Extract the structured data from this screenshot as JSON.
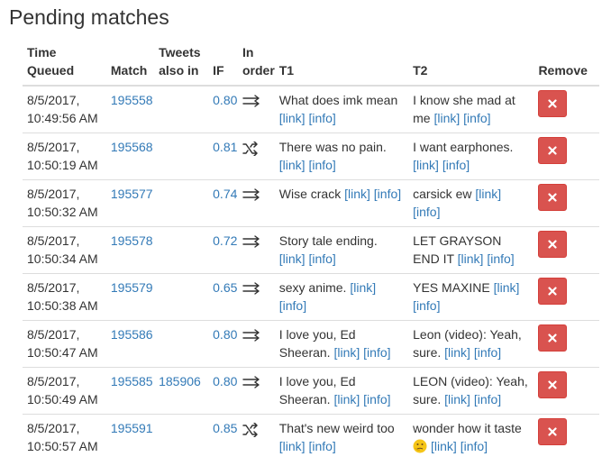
{
  "page": {
    "title": "Pending matches"
  },
  "headers": {
    "time": [
      "Time",
      "Queued"
    ],
    "match": "Match",
    "also": [
      "Tweets",
      "also in"
    ],
    "if": "IF",
    "order": [
      "In",
      "order"
    ],
    "t1": "T1",
    "t2": "T2",
    "remove": "Remove"
  },
  "link_label": "[link]",
  "info_label": "[info]",
  "colors": {
    "link": "#337ab7",
    "danger": "#d9534f",
    "border": "#dddddd",
    "text": "#333333"
  },
  "rows": [
    {
      "date": "8/5/2017,",
      "time": "10:49:56 AM",
      "match": "195558",
      "also": "",
      "if": "0.80",
      "order": "in-order-arrows-icon",
      "t1": "What does imk mean",
      "t2": "I know she mad at me",
      "t2_emoji": ""
    },
    {
      "date": "8/5/2017,",
      "time": "10:50:19 AM",
      "match": "195568",
      "also": "",
      "if": "0.81",
      "order": "shuffle-icon",
      "t1": "There was no pain.",
      "t2": "I want earphones.",
      "t2_emoji": ""
    },
    {
      "date": "8/5/2017,",
      "time": "10:50:32 AM",
      "match": "195577",
      "also": "",
      "if": "0.74",
      "order": "in-order-arrows-icon",
      "t1": "Wise crack",
      "t2": "carsick ew",
      "t2_emoji": ""
    },
    {
      "date": "8/5/2017,",
      "time": "10:50:34 AM",
      "match": "195578",
      "also": "",
      "if": "0.72",
      "order": "in-order-arrows-icon",
      "t1": "Story tale ending.",
      "t2": "LET GRAYSON END IT",
      "t2_emoji": ""
    },
    {
      "date": "8/5/2017,",
      "time": "10:50:38 AM",
      "match": "195579",
      "also": "",
      "if": "0.65",
      "order": "in-order-arrows-icon",
      "t1": "sexy anime.",
      "t2": "YES MAXINE",
      "t2_emoji": ""
    },
    {
      "date": "8/5/2017,",
      "time": "10:50:47 AM",
      "match": "195586",
      "also": "",
      "if": "0.80",
      "order": "in-order-arrows-icon",
      "t1": "I love you, Ed Sheeran.",
      "t2": "Leon (video): Yeah, sure.",
      "t2_emoji": ""
    },
    {
      "date": "8/5/2017,",
      "time": "10:50:49 AM",
      "match": "195585",
      "also": "185906",
      "if": "0.80",
      "order": "in-order-arrows-icon",
      "t1": "I love you, Ed Sheeran.",
      "t2": "LEON (video): Yeah, sure.",
      "t2_emoji": ""
    },
    {
      "date": "8/5/2017,",
      "time": "10:50:57 AM",
      "match": "195591",
      "also": "",
      "if": "0.85",
      "order": "shuffle-icon",
      "t1": "That's new weird too",
      "t2": "wonder how it taste",
      "t2_emoji": "thinking-face-emoji"
    }
  ]
}
